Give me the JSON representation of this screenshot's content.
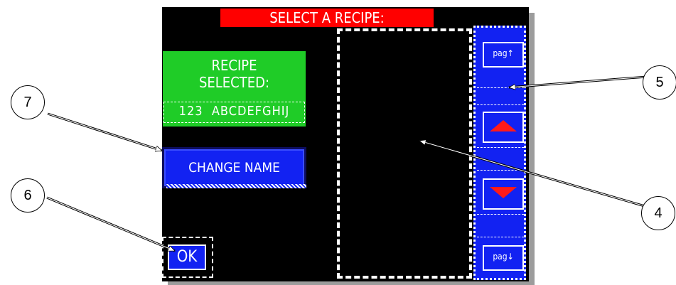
{
  "screen": {
    "title": "SELECT A RECIPE:",
    "recipe_selected_label": "RECIPE\nSELECTED:",
    "recipe_selected_value": "123  ABCDEFGHIJ",
    "change_name_label": "CHANGE NAME",
    "ok_label": "OK",
    "page_up_label": "pag↑",
    "page_down_label": "pag↓",
    "up_icon": "triangle-up-icon",
    "down_icon": "triangle-down-icon"
  },
  "callouts": [
    "4",
    "5",
    "6",
    "7"
  ],
  "colors": {
    "screen_bg": "#000000",
    "title_bg": "#ff0000",
    "selected_bg": "#1fcc27",
    "button_bg": "#1222f2",
    "arrow": "#ff1a1a"
  }
}
